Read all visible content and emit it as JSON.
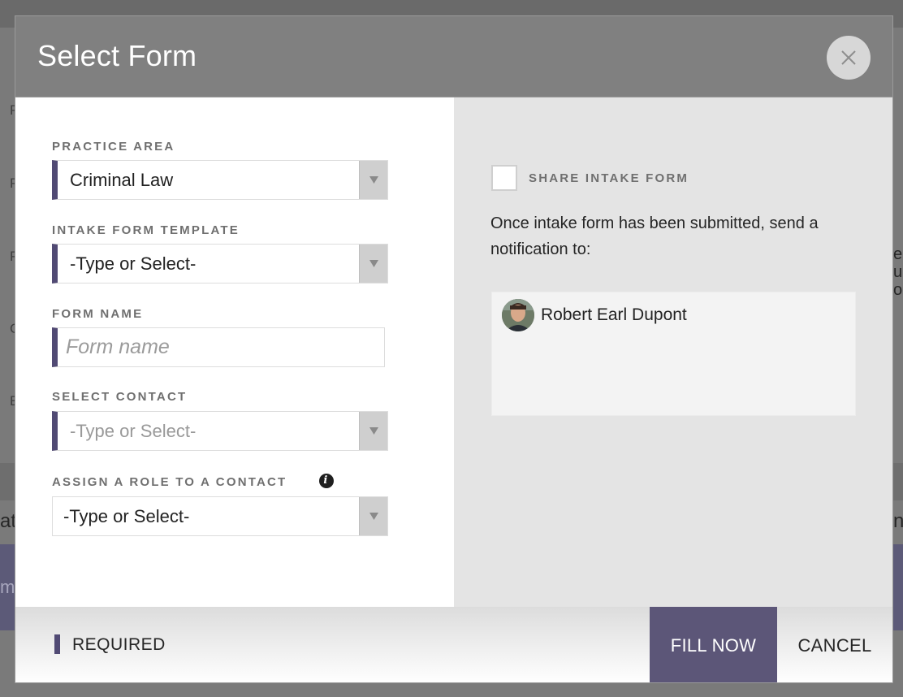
{
  "background": {
    "left_fragments": [
      "P",
      "P",
      "P",
      "C",
      "E"
    ],
    "tab_fragment_left": "at",
    "band_fragment_left": "ms",
    "right_fragments": [
      "e",
      "ur",
      "od"
    ],
    "tab_fragment_right": "n"
  },
  "modal": {
    "title": "Select Form",
    "close_icon": "close-icon"
  },
  "form": {
    "practice_area": {
      "label": "PRACTICE AREA",
      "value": "Criminal Law"
    },
    "template": {
      "label": "INTAKE FORM TEMPLATE",
      "value": "-Type or Select-"
    },
    "form_name": {
      "label": "FORM NAME",
      "placeholder": "Form name"
    },
    "contact": {
      "label": "SELECT CONTACT",
      "value": "-Type or Select-"
    },
    "role": {
      "label": "ASSIGN A ROLE TO A CONTACT",
      "value": "-Type or Select-",
      "info_icon": "info-icon"
    }
  },
  "share": {
    "label": "SHARE INTAKE FORM",
    "checked": false,
    "notify_text": "Once intake form has been submitted, send a notification to:",
    "recipients": [
      {
        "name": "Robert Earl Dupont"
      }
    ]
  },
  "footer": {
    "required_label": "REQUIRED",
    "fill_now": "FILL NOW",
    "cancel": "CANCEL"
  },
  "colors": {
    "accent": "#514a74",
    "primary_button": "#5c5678",
    "header": "#808080",
    "right_pane": "#e4e4e4"
  }
}
